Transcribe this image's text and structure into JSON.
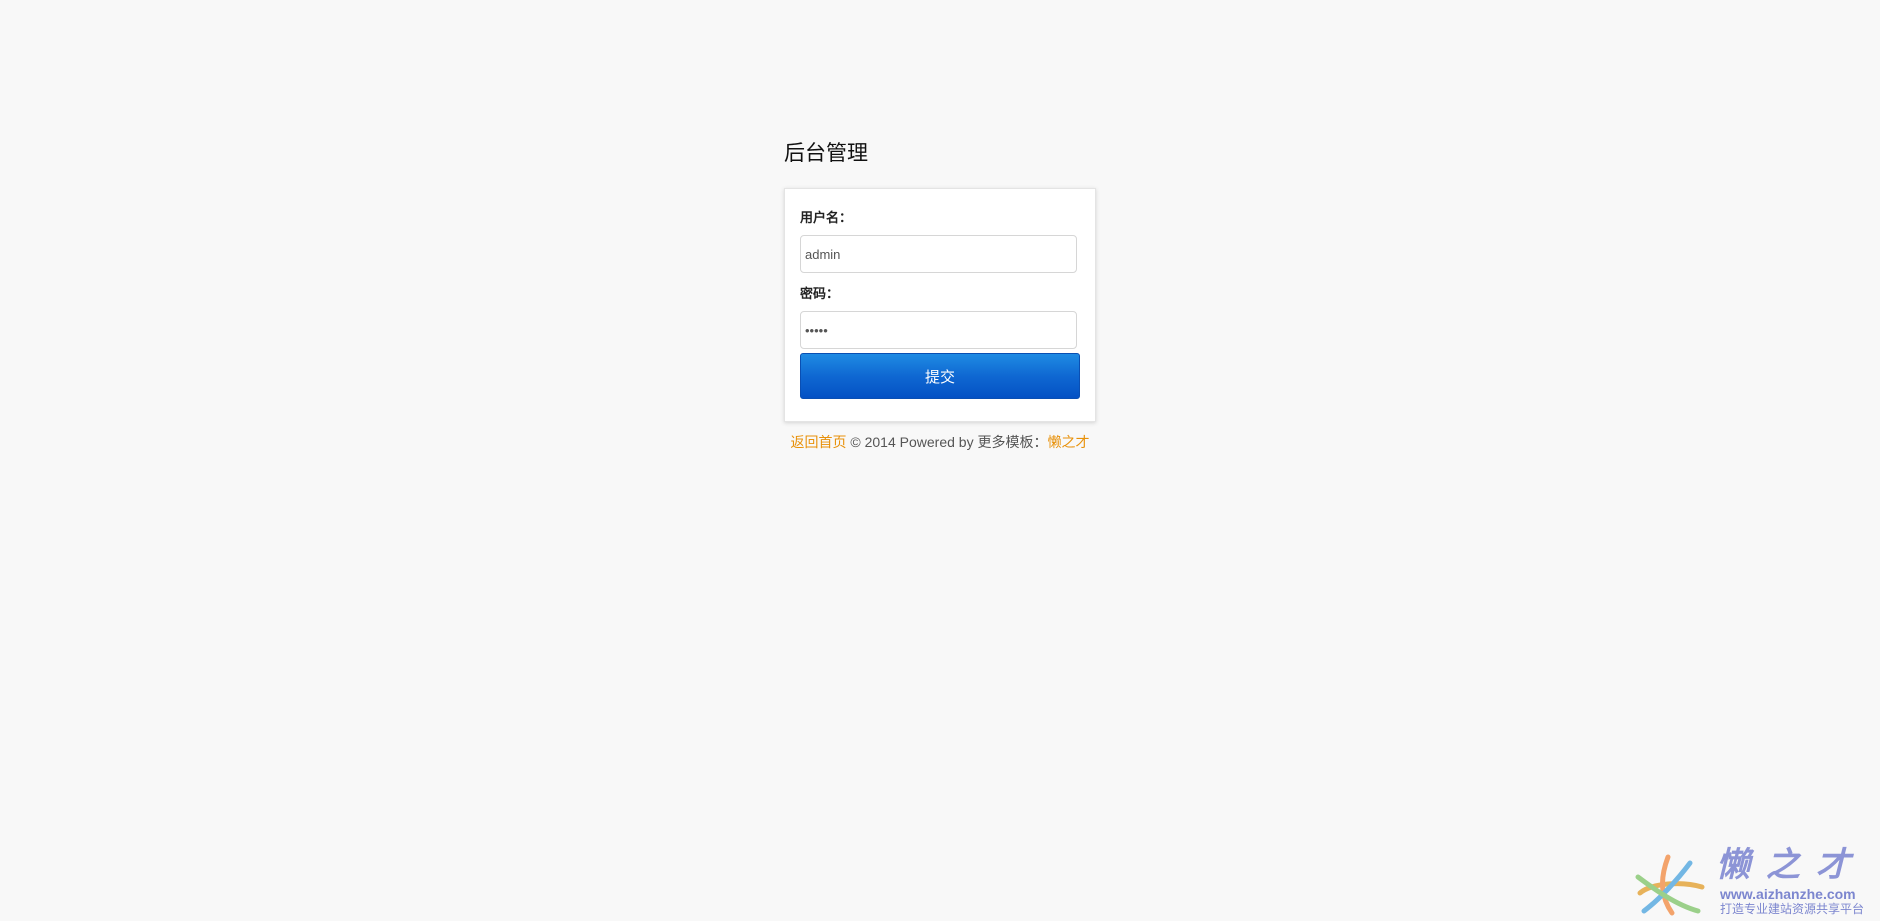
{
  "page": {
    "title": "后台管理"
  },
  "form": {
    "username_label": "用户名：",
    "username_value": "admin",
    "password_label": "密码：",
    "password_value": "•••••",
    "submit_label": "提交"
  },
  "footer": {
    "home_link": "返回首页",
    "copyright": " © 2014 Powered by 更多模板：",
    "brand_link": "懒之才"
  },
  "watermark": {
    "title": "懒之才",
    "url": "www.aizhanzhe.com",
    "slogan": "打造专业建站资源共享平台",
    "logo_icon": "star-swirl-icon"
  },
  "colors": {
    "background": "#f8f8f8",
    "accent_link": "#e8910a",
    "button_blue": "#0f68d2",
    "watermark": "#8c94d6"
  }
}
